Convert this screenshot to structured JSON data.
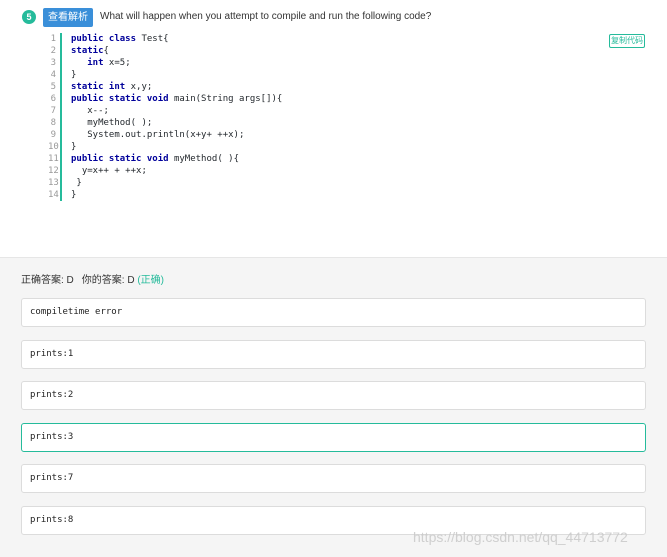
{
  "question": {
    "number": "5",
    "view_button_label": "查看解析",
    "text": "What will happen when you attempt to compile and run the following code?",
    "copy_button_label": "复制代码"
  },
  "code_lines": [
    {
      "n": "1",
      "html_kw": "public class",
      "rest": " Test{"
    },
    {
      "n": "2",
      "html_kw": "static",
      "rest": "{"
    },
    {
      "n": "3",
      "html_kw": "   int",
      "rest": " x=5;"
    },
    {
      "n": "4",
      "html_kw": "",
      "rest": "}"
    },
    {
      "n": "5",
      "html_kw": "static int",
      "rest": " x,y;"
    },
    {
      "n": "6",
      "html_kw": "public static void",
      "rest": " main(String args[]){"
    },
    {
      "n": "7",
      "html_kw": "",
      "rest": "   x--;"
    },
    {
      "n": "8",
      "html_kw": "",
      "rest": "   myMethod( );"
    },
    {
      "n": "9",
      "html_kw": "",
      "rest": "   System.out.println(x+y+ ++x);"
    },
    {
      "n": "10",
      "html_kw": "",
      "rest": "}"
    },
    {
      "n": "11",
      "html_kw": "public static void",
      "rest": " myMethod( ){"
    },
    {
      "n": "12",
      "html_kw": "",
      "rest": "  y=x++ + ++x;"
    },
    {
      "n": "13",
      "html_kw": "",
      "rest": " }"
    },
    {
      "n": "14",
      "html_kw": "",
      "rest": "}"
    }
  ],
  "answer": {
    "correct_label": "正确答案: D",
    "your_label": "你的答案: D",
    "status": "(正确)"
  },
  "options": [
    {
      "label": "compiletime error",
      "selected": false
    },
    {
      "label": "prints:1",
      "selected": false
    },
    {
      "label": "prints:2",
      "selected": false
    },
    {
      "label": "prints:3",
      "selected": true
    },
    {
      "label": "prints:7",
      "selected": false
    },
    {
      "label": "prints:8",
      "selected": false
    }
  ],
  "watermark": "https://blog.csdn.net/qq_44713772",
  "colors": {
    "accent": "#25bb9b",
    "button_blue": "#3a8fd9",
    "keyword": "#00009a"
  }
}
